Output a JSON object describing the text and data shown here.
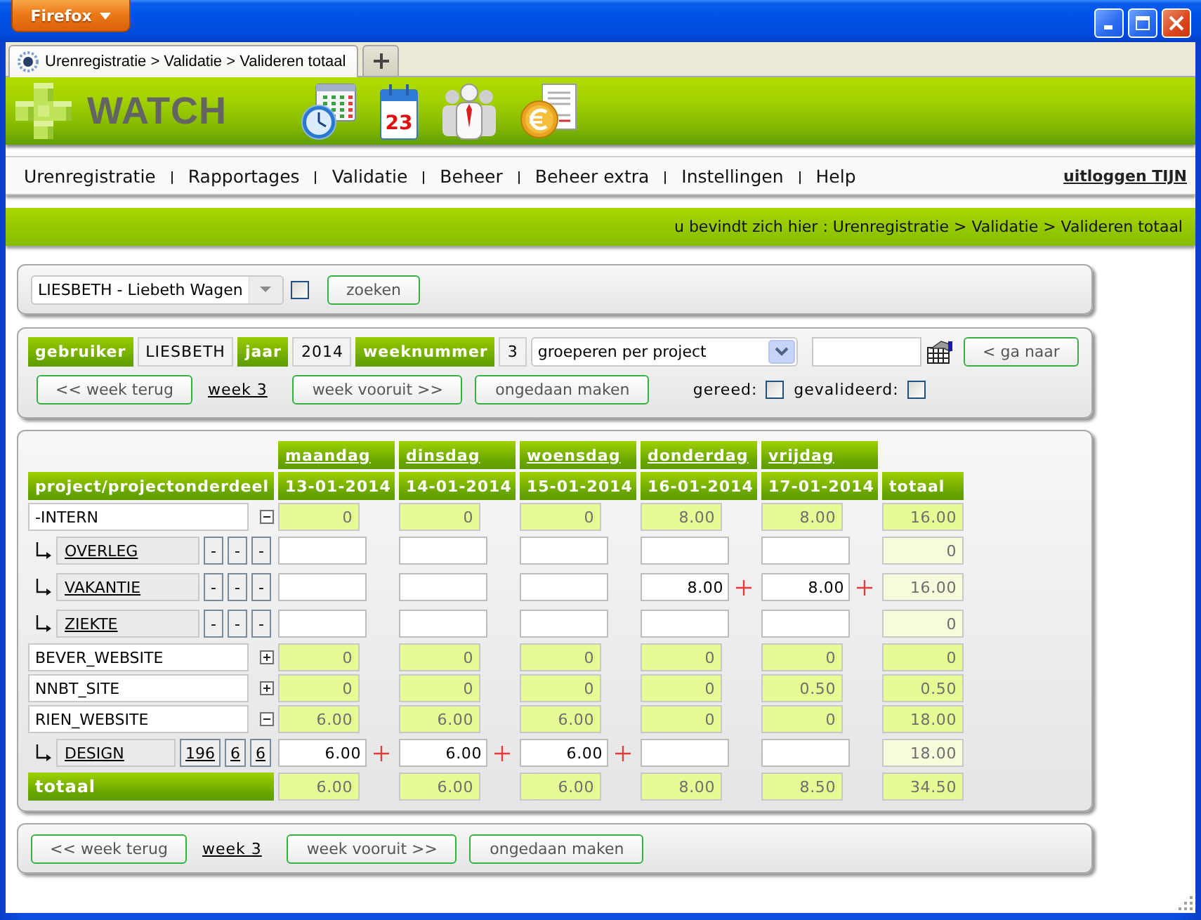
{
  "browser": {
    "menu_button": "Firefox",
    "tabs": [
      {
        "title": "Urenregistratie > Validatie > Valideren totaal",
        "selected": true
      }
    ]
  },
  "header": {
    "logo_text": "WATCH",
    "icons": [
      {
        "kind": "timesheet"
      },
      {
        "kind": "calendar",
        "day": "23"
      },
      {
        "kind": "team"
      },
      {
        "kind": "billing"
      }
    ]
  },
  "menu": {
    "items": [
      "Urenregistratie",
      "Rapportages",
      "Validatie",
      "Beheer",
      "Beheer extra",
      "Instellingen",
      "Help"
    ],
    "logout": "uitloggen TIJN"
  },
  "breadcrumb": "u bevindt zich hier : Urenregistratie > Validatie > Valideren totaal",
  "search_panel": {
    "user_select": "LIESBETH - Liebeth Wagen",
    "checked": false,
    "search_button": "zoeken"
  },
  "week_panel": {
    "fields": [
      {
        "label": "gebruiker",
        "value": "LIESBETH"
      },
      {
        "label": "jaar",
        "value": "2014"
      },
      {
        "label": "weeknummer",
        "value": "3"
      }
    ],
    "grouping_select": "groeperen per project",
    "goto_button": "< ga naar",
    "back_button": "<< week terug",
    "week_link": "week 3",
    "forward_button": "week vooruit >>",
    "undo_button": "ongedaan maken",
    "flags": [
      {
        "label": "gereed:",
        "checked": false
      },
      {
        "label": "gevalideerd:",
        "checked": false
      }
    ]
  },
  "table": {
    "name_header": "project/projectonderdeel",
    "days": [
      {
        "name": "maandag",
        "date": "13-01-2014"
      },
      {
        "name": "dinsdag",
        "date": "14-01-2014"
      },
      {
        "name": "woensdag",
        "date": "15-01-2014"
      },
      {
        "name": "donderdag",
        "date": "16-01-2014"
      },
      {
        "name": "vrijdag",
        "date": "17-01-2014"
      }
    ],
    "total_header": "totaal",
    "rows": [
      {
        "name": "-INTERN",
        "expanded": true,
        "cells": [
          "0",
          "0",
          "0",
          "8.00",
          "8.00"
        ],
        "total": "16.00",
        "children": [
          {
            "name": "OVERLEG",
            "codes": [
              {
                "text": "-",
                "link": false
              },
              {
                "text": "-",
                "link": false
              },
              {
                "text": "-",
                "link": false
              }
            ],
            "cells": [
              {
                "add": false
              },
              {
                "add": false
              },
              {
                "add": false
              },
              {
                "add": false
              },
              {
                "add": false
              }
            ],
            "total": "0"
          },
          {
            "name": "VAKANTIE",
            "codes": [
              {
                "text": "-",
                "link": false
              },
              {
                "text": "-",
                "link": false
              },
              {
                "text": "-",
                "link": false
              }
            ],
            "cells": [
              {
                "add": false
              },
              {
                "add": false
              },
              {
                "add": false
              },
              {
                "value": "8.00",
                "add": true
              },
              {
                "value": "8.00",
                "add": true
              }
            ],
            "total": "16.00"
          },
          {
            "name": "ZIEKTE",
            "codes": [
              {
                "text": "-",
                "link": false
              },
              {
                "text": "-",
                "link": false
              },
              {
                "text": "-",
                "link": false
              }
            ],
            "cells": [
              {
                "add": false
              },
              {
                "add": false
              },
              {
                "add": false
              },
              {
                "add": false
              },
              {
                "add": false
              }
            ],
            "total": "0"
          }
        ]
      },
      {
        "name": "BEVER_WEBSITE",
        "expanded": false,
        "cells": [
          "0",
          "0",
          "0",
          "0",
          "0"
        ],
        "total": "0"
      },
      {
        "name": "NNBT_SITE",
        "expanded": false,
        "cells": [
          "0",
          "0",
          "0",
          "0",
          "0.50"
        ],
        "total": "0.50"
      },
      {
        "name": "RIEN_WEBSITE",
        "expanded": true,
        "cells": [
          "6.00",
          "6.00",
          "6.00",
          "0",
          "0"
        ],
        "total": "18.00",
        "children": [
          {
            "name": "DESIGN",
            "codes": [
              {
                "text": "196",
                "link": true
              },
              {
                "text": "6",
                "link": true
              },
              {
                "text": "6",
                "link": true
              }
            ],
            "cells": [
              {
                "value": "6.00",
                "add": true
              },
              {
                "value": "6.00",
                "add": true
              },
              {
                "value": "6.00",
                "add": true
              },
              {
                "add": false
              },
              {
                "add": false
              }
            ],
            "total": "18.00"
          }
        ]
      }
    ],
    "totals": {
      "label": "totaal",
      "cells": [
        "6.00",
        "6.00",
        "6.00",
        "8.00",
        "8.50"
      ],
      "total": "34.50"
    }
  },
  "bottom_panel": {
    "back_button": "<< week terug",
    "week_link": "week 3",
    "forward_button": "week vooruit >>",
    "undo_button": "ongedaan maken"
  }
}
